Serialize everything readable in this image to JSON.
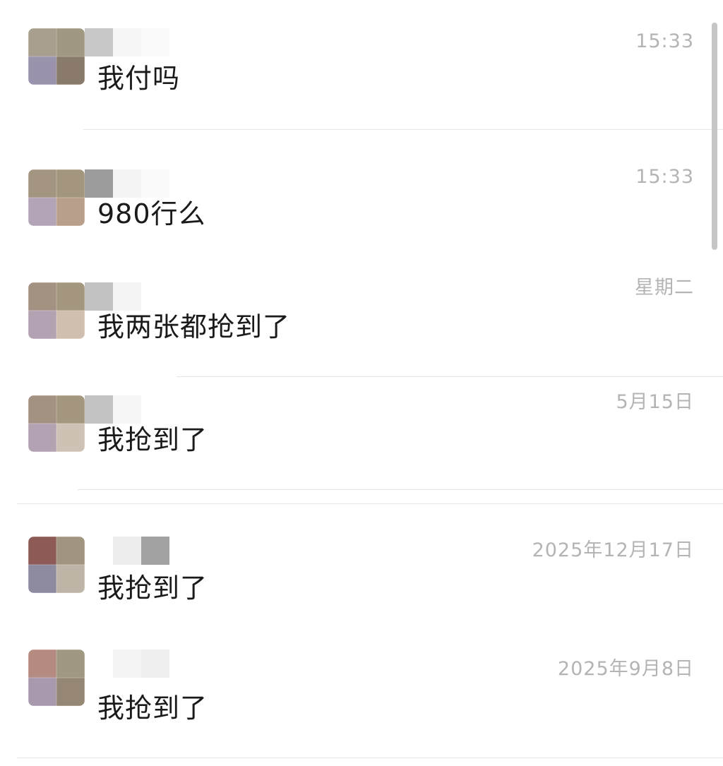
{
  "conversations": [
    {
      "message": "我付吗",
      "time": "15:33",
      "avatar_colors": [
        "#a89f8e",
        "#a09880",
        "#9b93ae",
        "#8a7a6c"
      ],
      "name_colors": [
        "#c8c8c8",
        "#f6f6f6",
        "#fafafa"
      ]
    },
    {
      "message": "980行么",
      "time": "15:33",
      "avatar_colors": [
        "#a39580",
        "#a4967e",
        "#b3a5b7",
        "#b89f8c"
      ],
      "name_colors": [
        "#9b9b9b",
        "#f3f3f3",
        "#fbfbfb"
      ]
    },
    {
      "message": "我两张都抢到了",
      "time": "星期二",
      "avatar_colors": [
        "#a39282",
        "#a4967f",
        "#b2a2b2",
        "#d0bfae"
      ],
      "name_colors": [
        "#c2c2c2",
        "#f4f4f4",
        "#ffffff"
      ]
    },
    {
      "message": "我抢到了",
      "time": "5月15日",
      "avatar_colors": [
        "#a39282",
        "#a4967f",
        "#b2a2b2",
        "#cec2b4"
      ],
      "name_colors": [
        "#c4c4c4",
        "#f7f7f7",
        "#ffffff"
      ]
    },
    {
      "message": "我抢到了",
      "time": "2025年12月17日",
      "avatar_colors": [
        "#8d5a56",
        "#a1957f",
        "#8e8a9f",
        "#bfb5a6"
      ],
      "name_colors": [
        "#ffffff",
        "#ededed",
        "#a2a2a2"
      ]
    },
    {
      "message": "我抢到了",
      "time": "2025年9月8日",
      "avatar_colors": [
        "#b58a80",
        "#a09880",
        "#a79aae",
        "#968775"
      ],
      "name_colors": [
        "#ffffff",
        "#f3f3f3",
        "#efefef"
      ]
    }
  ],
  "theme": {
    "background": "#ffffff",
    "message_color": "#1a1a1a",
    "time_color": "#b4b4b4",
    "divider_color": "#e6e6e6",
    "scrollbar_color": "#c6c6c6"
  }
}
